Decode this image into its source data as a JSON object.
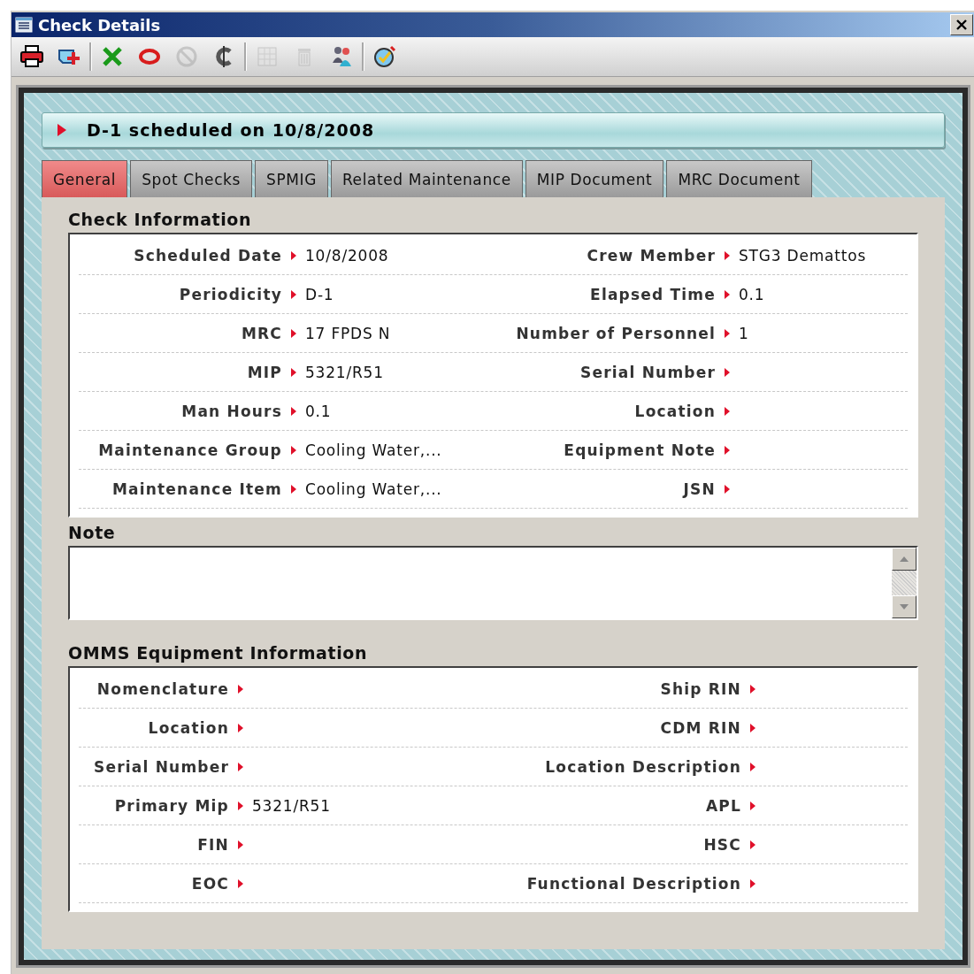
{
  "window": {
    "title": "Check Details"
  },
  "toolbar": {
    "groups": [
      [
        {
          "disabled": false
        },
        {
          "disabled": false
        }
      ],
      [
        {
          "disabled": false
        },
        {
          "disabled": false
        },
        {
          "disabled": true
        },
        {
          "disabled": false
        }
      ],
      [
        {
          "disabled": true
        },
        {
          "disabled": true
        },
        {
          "disabled": false
        }
      ],
      [
        {
          "disabled": false
        }
      ]
    ]
  },
  "header": {
    "title": "D-1 scheduled on 10/8/2008"
  },
  "tabs": [
    {
      "label": "General",
      "selected": true
    },
    {
      "label": "Spot Checks",
      "selected": false
    },
    {
      "label": "SPMIG",
      "selected": false
    },
    {
      "label": "Related Maintenance",
      "selected": false
    },
    {
      "label": "MIP Document",
      "selected": false
    },
    {
      "label": "MRC Document",
      "selected": false
    }
  ],
  "check_information": {
    "title": "Check Information",
    "rows": [
      {
        "left": {
          "label": "Scheduled Date",
          "value": "10/8/2008"
        },
        "right": {
          "label": "Crew Member",
          "value": "STG3 Demattos"
        }
      },
      {
        "left": {
          "label": "Periodicity",
          "value": "D-1"
        },
        "right": {
          "label": "Elapsed Time",
          "value": "0.1"
        }
      },
      {
        "left": {
          "label": "MRC",
          "value": "17 FPDS N"
        },
        "right": {
          "label": "Number of Personnel",
          "value": "1"
        }
      },
      {
        "left": {
          "label": "MIP",
          "value": "5321/R51"
        },
        "right": {
          "label": "Serial Number"
        }
      },
      {
        "left": {
          "label": "Man Hours",
          "value": "0.1"
        },
        "right": {
          "label": "Location"
        }
      },
      {
        "left": {
          "label": "Maintenance Group",
          "value": "Cooling Water,..."
        },
        "right": {
          "label": "Equipment Note"
        }
      },
      {
        "left": {
          "label": "Maintenance Item",
          "value": "Cooling Water,..."
        },
        "right": {
          "label": "JSN"
        }
      }
    ]
  },
  "note": {
    "title": "Note"
  },
  "omms_equipment_information": {
    "title": "OMMS Equipment Information",
    "rows": [
      {
        "left": {
          "label": "Nomenclature"
        },
        "right": {
          "label": "Ship RIN"
        }
      },
      {
        "left": {
          "label": "Location"
        },
        "right": {
          "label": "CDM RIN"
        }
      },
      {
        "left": {
          "label": "Serial Number"
        },
        "right": {
          "label": "Location Description"
        }
      },
      {
        "left": {
          "label": "Primary Mip",
          "value": "5321/R51"
        },
        "right": {
          "label": "APL"
        }
      },
      {
        "left": {
          "label": "FIN"
        },
        "right": {
          "label": "HSC"
        }
      },
      {
        "left": {
          "label": "EOC"
        },
        "right": {
          "label": "Functional Description"
        }
      }
    ]
  }
}
